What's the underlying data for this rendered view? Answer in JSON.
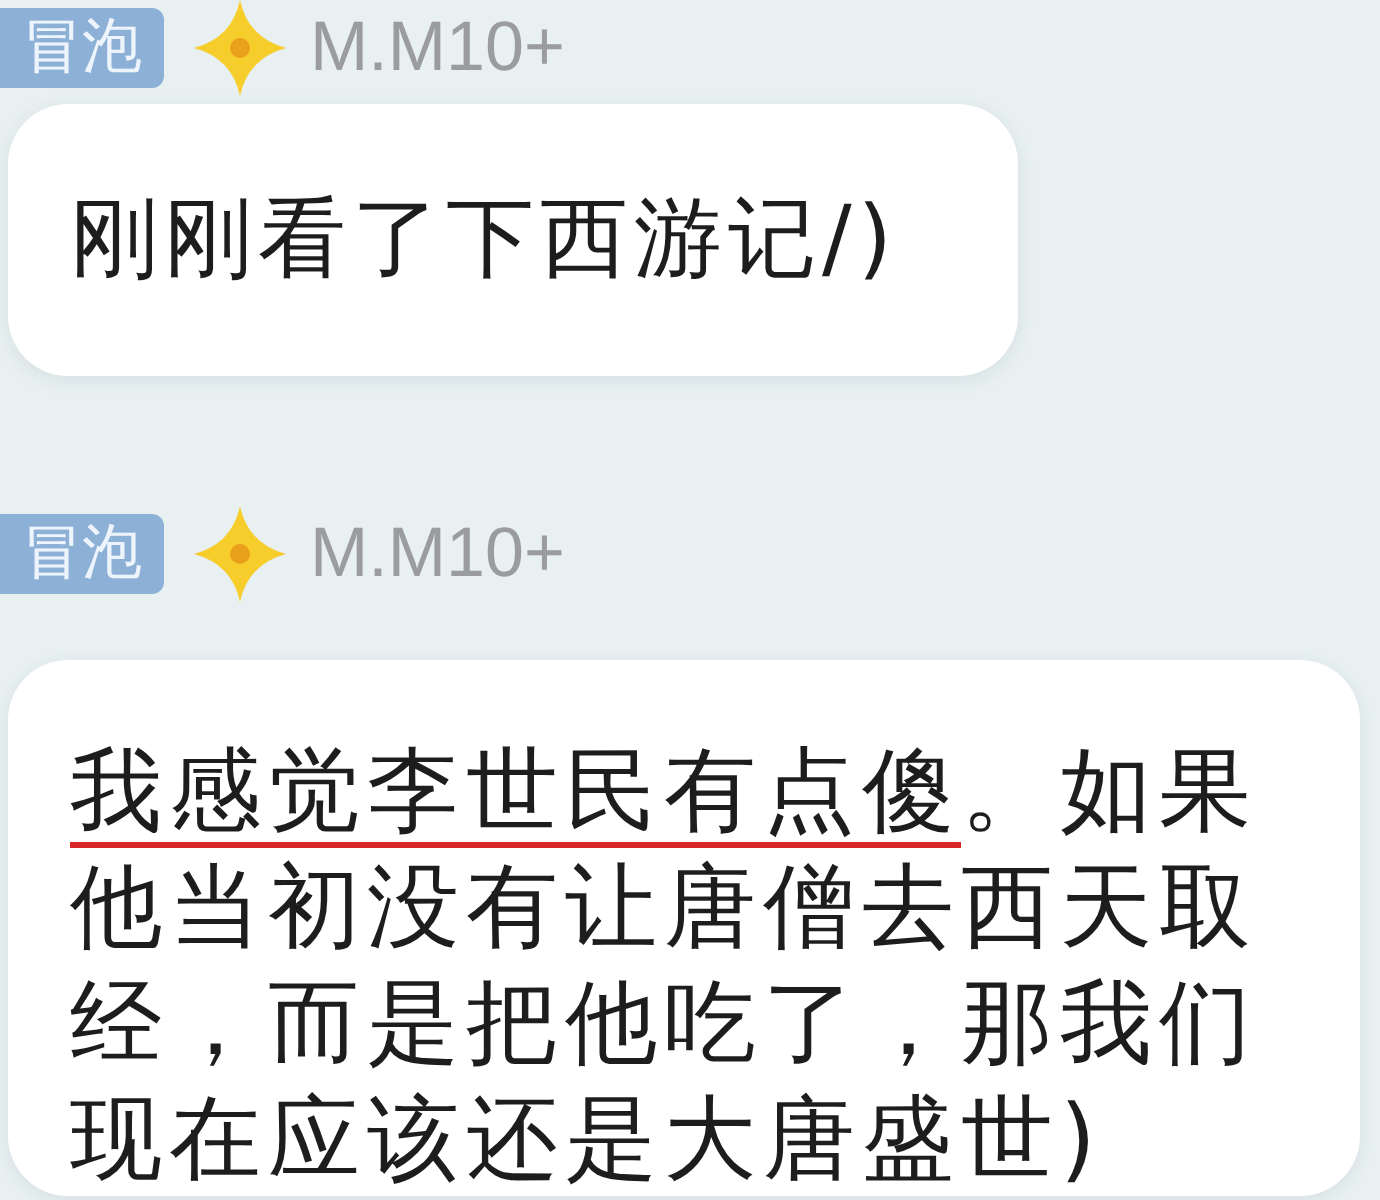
{
  "messages": [
    {
      "sender": {
        "badge": "冒泡",
        "name": "M.M10+"
      },
      "segments": [
        {
          "text": "刚刚看了下西游记/)",
          "underlined": false
        }
      ]
    },
    {
      "sender": {
        "badge": "冒泡",
        "name": "M.M10+"
      },
      "segments": [
        {
          "text": "我感觉李世民有点傻",
          "underlined": true
        },
        {
          "text": "。如果他当初没有让唐僧去西天取经，而是把他吃了，那我们现在应该还是大唐盛世)",
          "underlined": false
        }
      ]
    }
  ]
}
